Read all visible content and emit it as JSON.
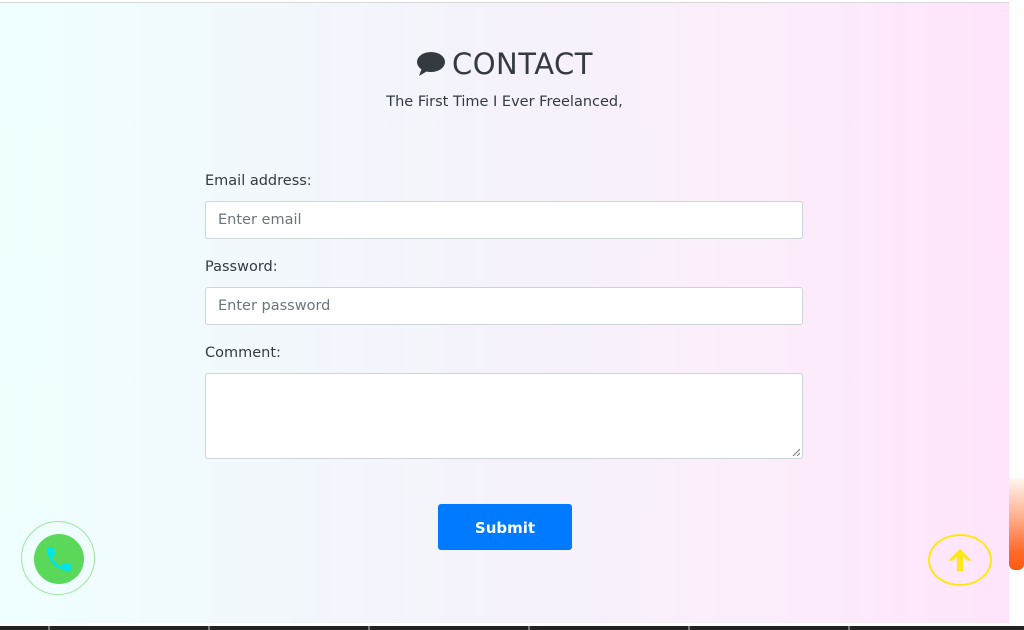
{
  "header": {
    "title": "CONTACT",
    "icon": "chat-bubble-icon",
    "subtitle": "The First Time I Ever Freelanced,"
  },
  "form": {
    "email": {
      "label": "Email address:",
      "placeholder": "Enter email",
      "value": ""
    },
    "password": {
      "label": "Password:",
      "placeholder": "Enter password",
      "value": ""
    },
    "comment": {
      "label": "Comment:",
      "value": ""
    },
    "submit_label": "Submit"
  },
  "floating": {
    "phone_icon": "phone-icon",
    "scroll_top_icon": "arrow-up-icon"
  },
  "colors": {
    "primary": "#007bff",
    "phone_green": "#5ad85a",
    "phone_handset": "#00e5e5",
    "scroll_top_yellow": "#ffe81a",
    "text_dark": "#343a40"
  }
}
